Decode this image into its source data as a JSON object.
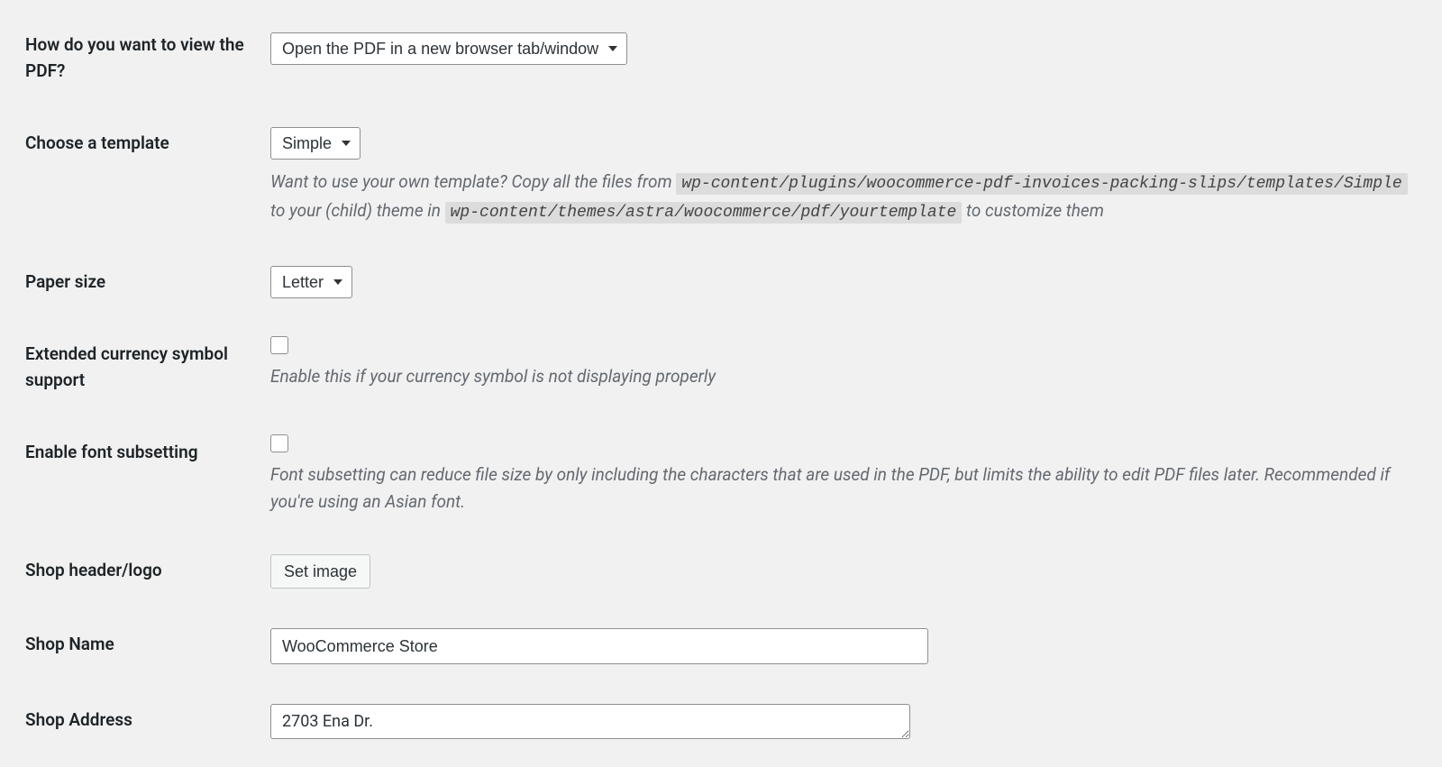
{
  "rows": {
    "viewPdf": {
      "label": "How do you want to view the PDF?",
      "value": "Open the PDF in a new browser tab/window"
    },
    "template": {
      "label": "Choose a template",
      "value": "Simple",
      "descPart1": "Want to use your own template? Copy all the files from ",
      "codePath1": "wp-content/plugins/woocommerce-pdf-invoices-packing-slips/templates/Simple",
      "descPart2": " to your (child) theme in ",
      "codePath2": "wp-content/themes/astra/woocommerce/pdf/yourtemplate",
      "descPart3": " to customize them"
    },
    "paperSize": {
      "label": "Paper size",
      "value": "Letter"
    },
    "currencySupport": {
      "label": "Extended currency symbol support",
      "desc": "Enable this if your currency symbol is not displaying properly"
    },
    "fontSubsetting": {
      "label": "Enable font subsetting",
      "desc": "Font subsetting can reduce file size by only including the characters that are used in the PDF, but limits the ability to edit PDF files later. Recommended if you're using an Asian font."
    },
    "shopLogo": {
      "label": "Shop header/logo",
      "button": "Set image"
    },
    "shopName": {
      "label": "Shop Name",
      "value": "WooCommerce Store"
    },
    "shopAddress": {
      "label": "Shop Address",
      "value": "2703 Ena Dr."
    }
  }
}
